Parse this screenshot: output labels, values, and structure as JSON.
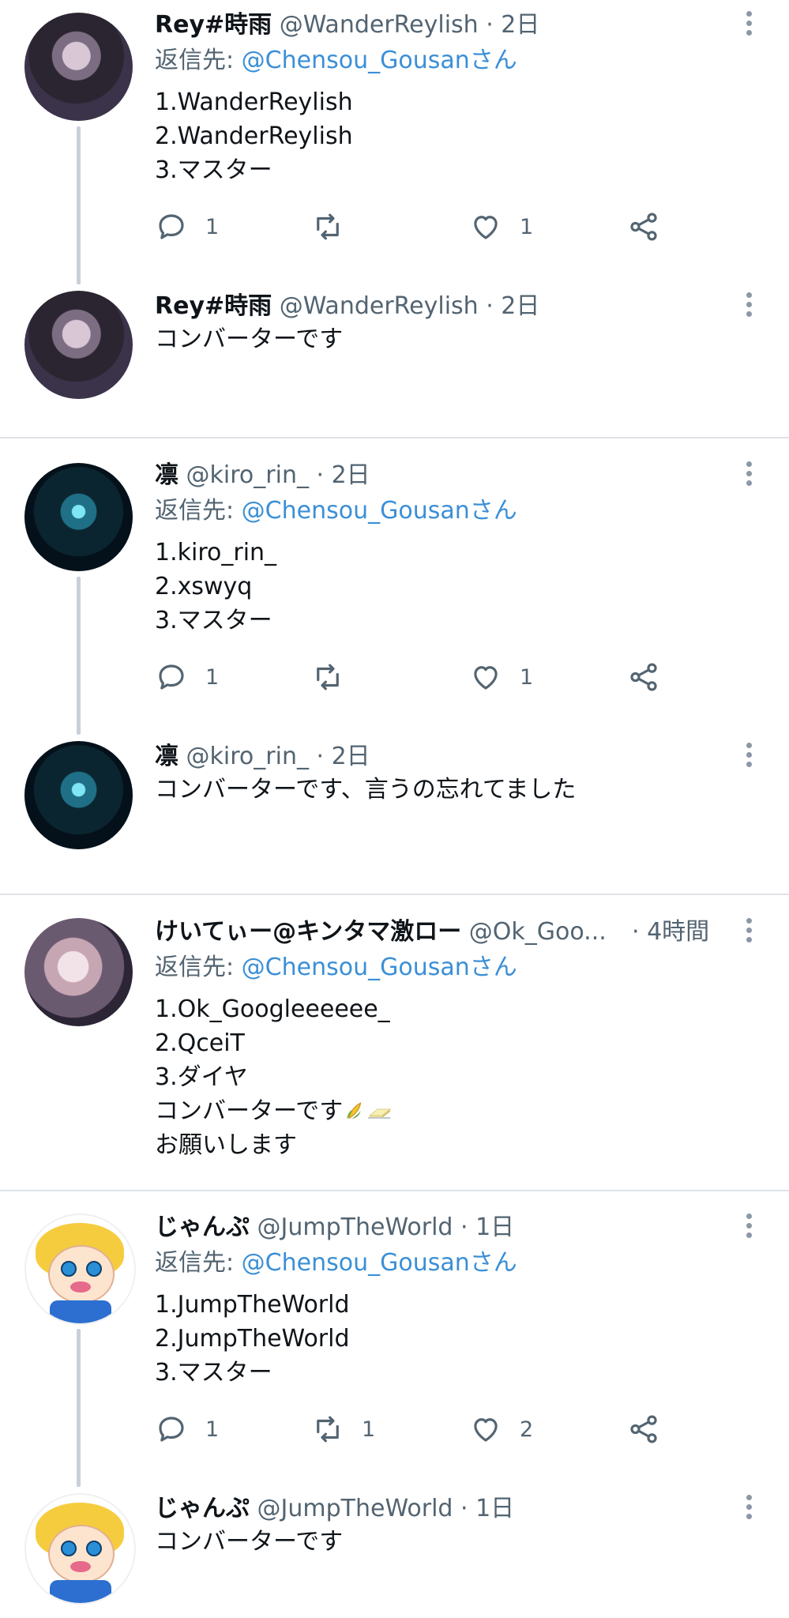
{
  "colors": {
    "text": "#0f1419",
    "secondary": "#536471",
    "mention": "#3b8fd6",
    "separator": "#dfe3e7",
    "thread_line": "#c9d0d6"
  },
  "icons": {
    "reply": "speech-bubble-icon",
    "retweet": "retweet-arrows-icon",
    "like": "heart-icon",
    "share": "share-nodes-icon",
    "more": "vertical-dots-icon"
  },
  "tweets": [
    {
      "name": "Rey#時雨",
      "handle": "@WanderReylish",
      "time": "· 2日",
      "reply_label": "返信先: ",
      "reply_mention": "@Chensou_Gousanさん",
      "lines": [
        "1.WanderReylish",
        "2.WanderReylish",
        "3.マスター"
      ],
      "reply_count": "1",
      "retweet_count": "",
      "like_count": "1"
    },
    {
      "name": "Rey#時雨",
      "handle": "@WanderReylish",
      "time": "· 2日",
      "lines": [
        "コンバーターです"
      ]
    },
    {
      "name": "凛",
      "handle": "@kiro_rin_",
      "time": "· 2日",
      "reply_label": "返信先: ",
      "reply_mention": "@Chensou_Gousanさん",
      "lines": [
        "1.kiro_rin_",
        "2.xswyq",
        "3.マスター"
      ],
      "reply_count": "1",
      "retweet_count": "",
      "like_count": "1"
    },
    {
      "name": "凛",
      "handle": "@kiro_rin_",
      "time": "· 2日",
      "lines": [
        "コンバーターです、言うの忘れてました"
      ]
    },
    {
      "name": "けいてぃー@キンタマ激ロー",
      "handle": "@Ok_Goo...",
      "time": "· 4時間",
      "reply_label": "返信先: ",
      "reply_mention": "@Chensou_Gousanさん",
      "lines": [
        "1.Ok_Googleeeeee_",
        "2.QceiT",
        "3.ダイヤ",
        "コンバーターです",
        "お願いします"
      ]
    },
    {
      "name": "じゃんぷ",
      "handle": "@JumpTheWorld",
      "time": "· 1日",
      "reply_label": "返信先: ",
      "reply_mention": "@Chensou_Gousanさん",
      "lines": [
        "1.JumpTheWorld",
        "2.JumpTheWorld",
        "3.マスター"
      ],
      "reply_count": "1",
      "retweet_count": "1",
      "like_count": "2"
    },
    {
      "name": "じゃんぷ",
      "handle": "@JumpTheWorld",
      "time": "· 1日",
      "lines": [
        "コンバーターです"
      ]
    }
  ]
}
